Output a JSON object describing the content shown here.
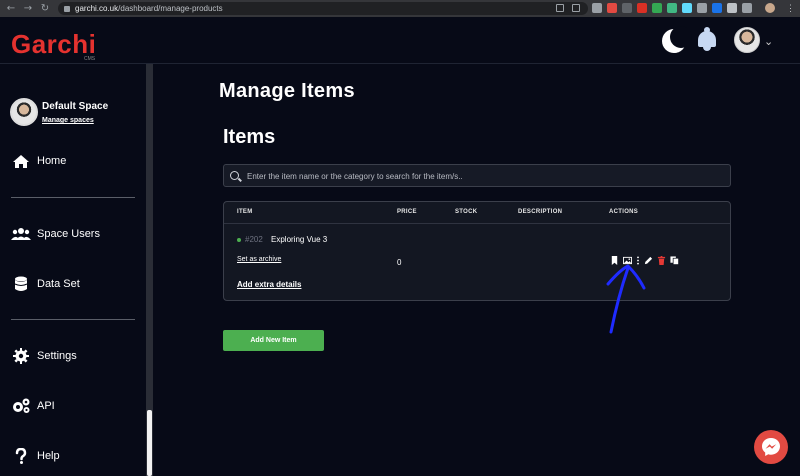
{
  "browser": {
    "url_domain": "garchi.co.uk",
    "url_path": "/dashboard/manage-products"
  },
  "header": {
    "logo": "Garchi",
    "logo_sub": "CMS"
  },
  "sidebar": {
    "space_name": "Default Space",
    "manage_spaces": "Manage spaces",
    "items": [
      {
        "label": "Home"
      },
      {
        "label": "Space Users"
      },
      {
        "label": "Data Set"
      },
      {
        "label": "Settings"
      },
      {
        "label": "API"
      },
      {
        "label": "Help"
      }
    ]
  },
  "main": {
    "page_title": "Manage Items",
    "section_title": "Items",
    "search_placeholder": "Enter the item name or the category to search for the item/s..",
    "table": {
      "headers": [
        "ITEM",
        "PRICE",
        "STOCK",
        "DESCRIPTION",
        "ACTIONS"
      ],
      "rows": [
        {
          "id": "#202",
          "name": "Exploring Vue 3",
          "archive_link": "Set as archive",
          "extra_link": "Add extra details",
          "price": "0",
          "status_color": "#4caf50"
        }
      ]
    },
    "add_button": "Add New Item"
  },
  "colors": {
    "brand": "#e5322f",
    "accent": "#4caf50",
    "background": "#070a17",
    "annotation": "#1f2bff"
  }
}
